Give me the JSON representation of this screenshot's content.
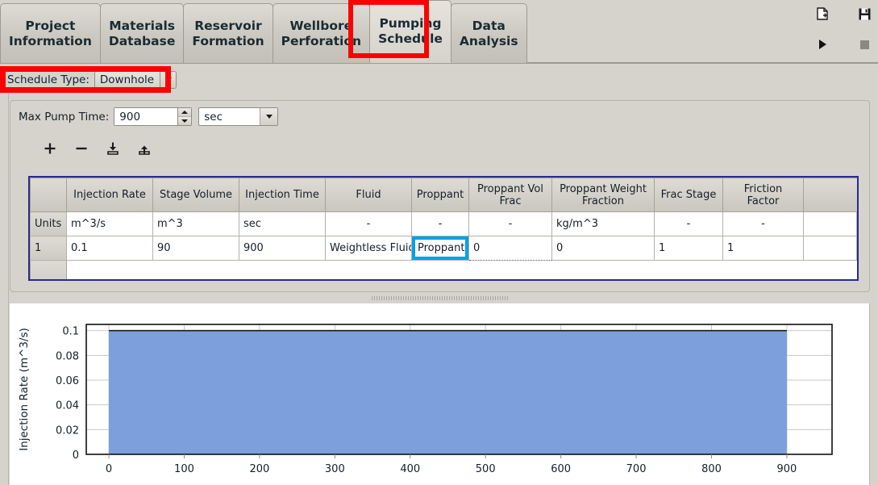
{
  "tabs": [
    {
      "label": "Project\nInformation",
      "active": false,
      "name": "tab-project-information"
    },
    {
      "label": "Materials\nDatabase",
      "active": false,
      "name": "tab-materials-database"
    },
    {
      "label": "Reservoir\nFormation",
      "active": false,
      "name": "tab-reservoir-formation"
    },
    {
      "label": "Wellbore\nPerforation",
      "active": false,
      "name": "tab-wellbore-perforation"
    },
    {
      "label": "Pumping\nSchedule",
      "active": true,
      "name": "tab-pumping-schedule"
    },
    {
      "label": "Data\nAnalysis",
      "active": false,
      "name": "tab-data-analysis"
    }
  ],
  "schedule_type": {
    "label": "Schedule Type:",
    "value": "Downhole"
  },
  "max_pump_time": {
    "label": "Max Pump Time:",
    "value": "900",
    "unit": "sec"
  },
  "toolbar": {
    "add_label": "+",
    "remove_label": "−",
    "import_icon": "download-icon",
    "export_icon": "upload-icon"
  },
  "corner_icons": {
    "new_document": "new-document-icon",
    "save": "save-floppy-icon",
    "run": "play-icon",
    "stop": "stop-icon"
  },
  "table": {
    "columns": [
      "",
      "Injection Rate",
      "Stage Volume",
      "Injection Time",
      "Fluid",
      "Proppant",
      "Proppant Vol Frac",
      "Proppant Weight Fraction",
      "Frac Stage",
      "Friction Factor",
      ""
    ],
    "units_row": {
      "header": "Units",
      "cells": [
        "m^3/s",
        "m^3",
        "sec",
        "-",
        "-",
        "-",
        "kg/m^3",
        "-",
        "-"
      ]
    },
    "rows": [
      {
        "header": "1",
        "cells": [
          "0.1",
          "90",
          "900",
          "Weightless Fluid",
          "Proppant",
          "0",
          "0",
          "1",
          "1"
        ],
        "selected_cell_index": 4,
        "focused_cell_index": 5
      }
    ],
    "selection_color": "#00a2e8",
    "border_color": "#2a2a8c"
  },
  "chart_data": {
    "type": "area",
    "title": "",
    "xlabel": "",
    "ylabel": "Injection Rate (m^3/s)",
    "x": [
      0,
      900
    ],
    "values": [
      0.1,
      0.1
    ],
    "xlim": [
      -30,
      960
    ],
    "ylim": [
      0,
      0.105
    ],
    "xticks": [
      0,
      100,
      200,
      300,
      400,
      500,
      600,
      700,
      800,
      900
    ],
    "yticks": [
      0,
      0.02,
      0.04,
      0.06,
      0.08,
      0.1
    ],
    "ytick_labels": [
      "0",
      "0.02",
      "0.04",
      "0.06",
      "0.08",
      "0.1"
    ],
    "xtick_labels": [
      "0",
      "100",
      "200",
      "300",
      "400",
      "500",
      "600",
      "700",
      "800",
      "900"
    ],
    "grid": true,
    "legend": null,
    "area_color": "#7d9fdb",
    "line_color": "#1a1a1a"
  },
  "annotations": {
    "highlight_color": "#fe0000",
    "boxes": [
      "pumping-schedule-tab",
      "schedule-type-row"
    ]
  }
}
